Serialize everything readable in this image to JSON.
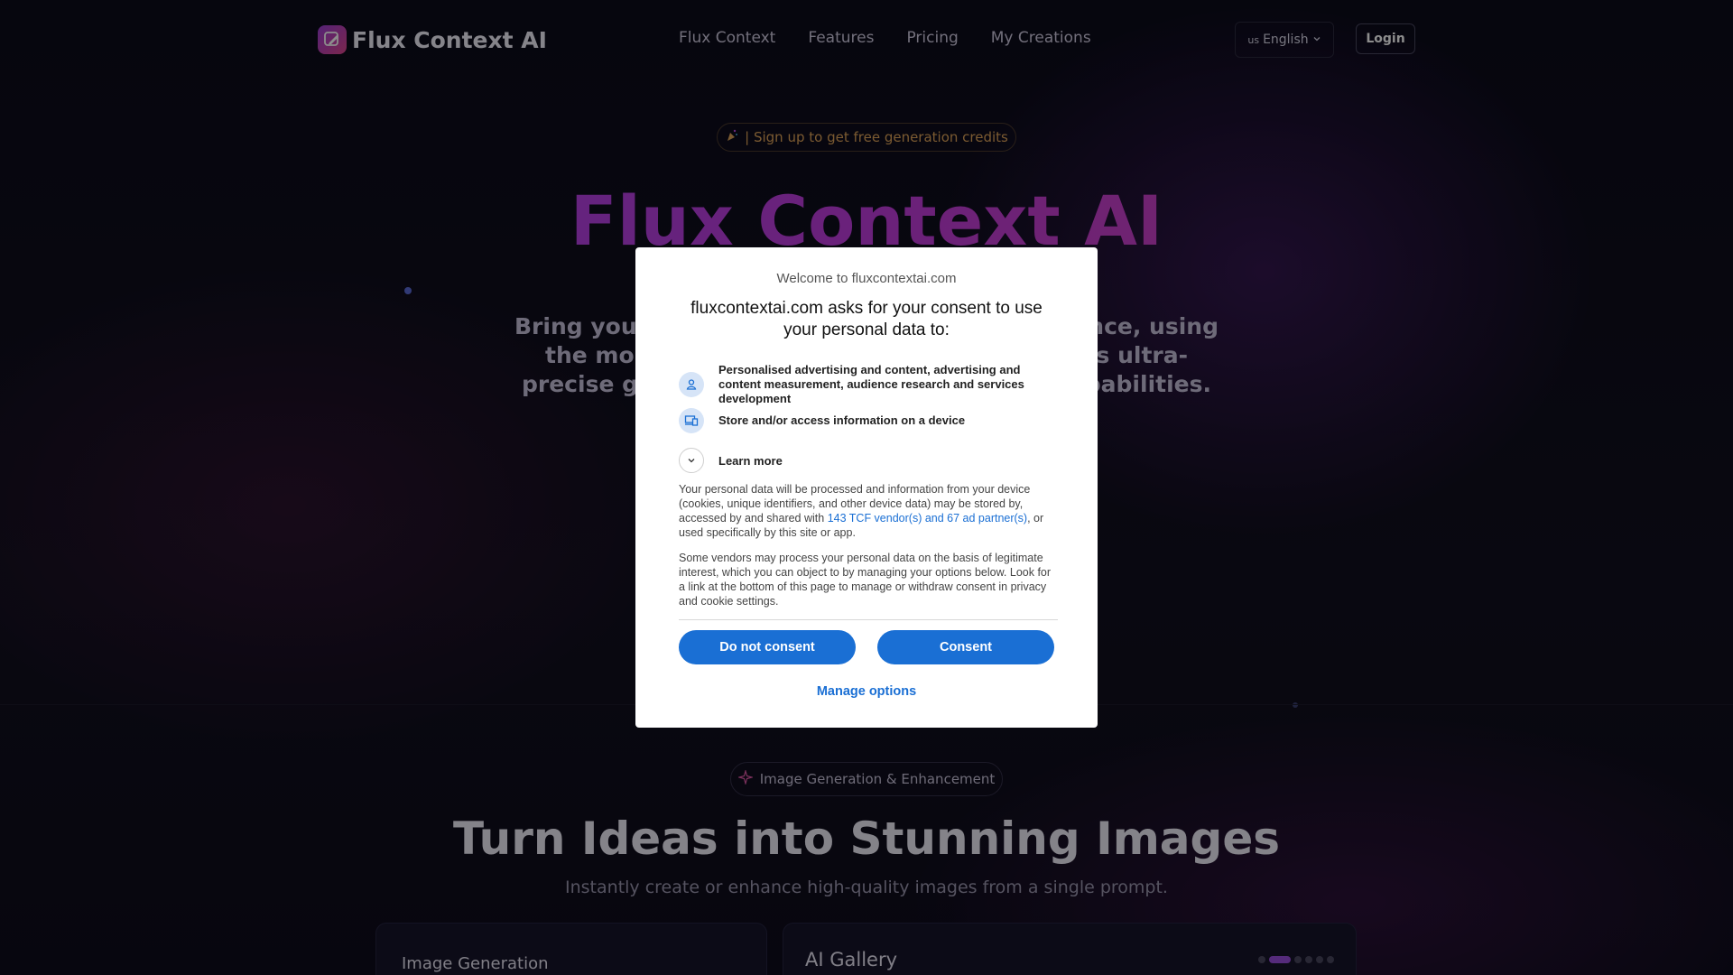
{
  "nav": {
    "logo_text": "Flux Context AI",
    "links": [
      "Flux Context",
      "Features",
      "Pricing",
      "My Creations"
    ],
    "language_code": "us",
    "language_label": "English",
    "login_label": "Login"
  },
  "hero": {
    "promo_text": "| Sign up to get free generation credits",
    "title": "Flux Context AI",
    "subtitle_lines": [
      "Bring you",
      "nce, using",
      "the mo",
      "s ultra-",
      "precise g",
      "pabilities."
    ]
  },
  "section": {
    "badge": "Image Generation & Enhancement",
    "title": "Turn Ideas into Stunning Images",
    "subtitle": "Instantly create or enhance high-quality images from a single prompt.",
    "card_left_title": "Image Generation",
    "card_right_title": "AI Gallery"
  },
  "dialog": {
    "welcome": "Welcome to fluxcontextai.com",
    "heading": "fluxcontextai.com asks for your consent to use your personal data to:",
    "purposes": [
      "Personalised advertising and content, advertising and content measurement, audience research and services development",
      "Store and/or access information on a device"
    ],
    "learn_more": "Learn more",
    "para1_before": "Your personal data will be processed and information from your device (cookies, unique identifiers, and other device data) may be stored by, accessed by and shared with ",
    "para1_link": "143 TCF vendor(s) and 67 ad partner(s)",
    "para1_after": ", or used specifically by this site or app.",
    "para2": "Some vendors may process your personal data on the basis of legitimate interest, which you can object to by managing your options below. Look for a link at the bottom of this page to manage or withdraw consent in privacy and cookie settings.",
    "do_not_consent": "Do not consent",
    "consent": "Consent",
    "manage_options": "Manage options"
  },
  "colors": {
    "accent": "#1a6fd4",
    "brand_gradient_start": "#a44cf0",
    "brand_gradient_end": "#e04aa8"
  }
}
